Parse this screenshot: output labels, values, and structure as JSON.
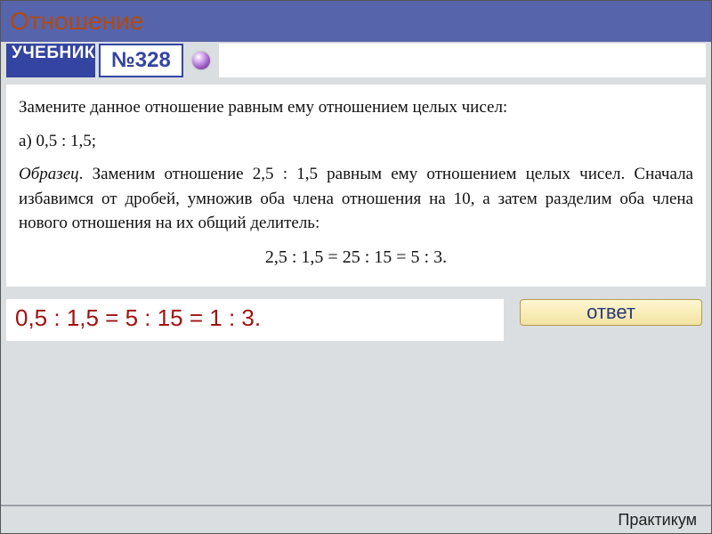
{
  "header": {
    "title": "Отношение"
  },
  "toolbar": {
    "book_label": "УЧЕБНИК",
    "problem_number": "№328"
  },
  "problem": {
    "prompt": "Замените данное отношение равным ему отношением целых чисел:",
    "item_a": "а) 0,5 : 1,5;",
    "sample_label": "Образец",
    "sample_text_after": ". Заменим отношение 2,5 : 1,5 равным ему отношением целых чисел. Сначала избавимся от дробей, умножив оба члена отношения на 10, а затем разделим оба члена нового отношения на их общий делитель:",
    "sample_equation": "2,5 : 1,5 = 25 : 15 = 5 : 3."
  },
  "answer": {
    "text": "0,5 : 1,5 = 5 : 15 = 1 : 3.",
    "button_label": "ответ"
  },
  "footer": {
    "label": "Практикум"
  }
}
